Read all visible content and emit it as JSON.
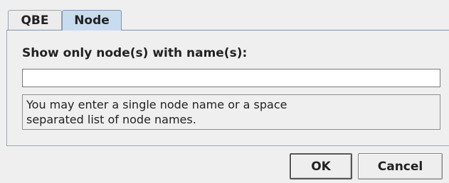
{
  "tabs": [
    {
      "label": "QBE",
      "selected": false
    },
    {
      "label": "Node",
      "selected": true
    }
  ],
  "node_filter": {
    "heading": "Show only node(s) with name(s):",
    "input_value": "",
    "hint_line1": "You may enter a single node name or a space",
    "hint_line2": "separated list of node names."
  },
  "buttons": {
    "ok_label": "OK",
    "cancel_label": "Cancel"
  }
}
